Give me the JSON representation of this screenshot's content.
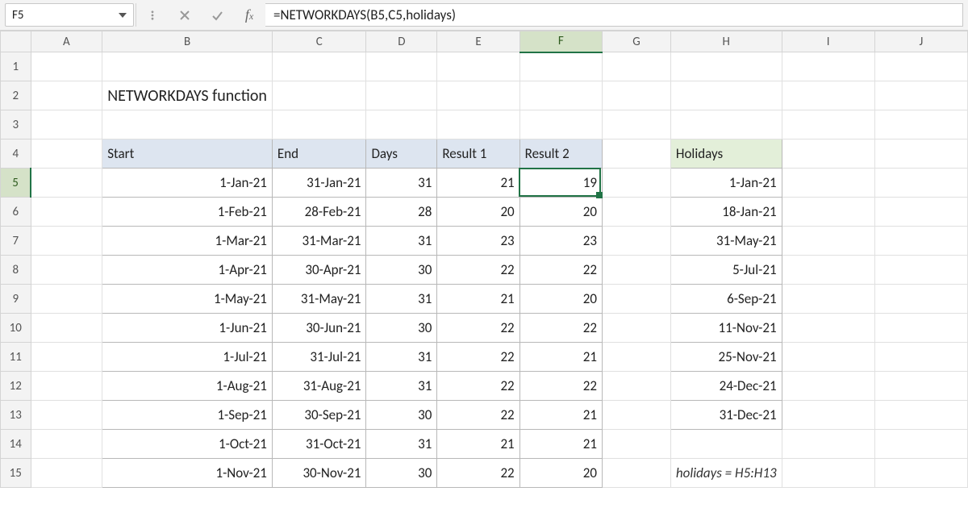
{
  "name_box": "F5",
  "formula": "=NETWORKDAYS(B5,C5,holidays)",
  "columns": [
    "A",
    "B",
    "C",
    "D",
    "E",
    "F",
    "G",
    "H",
    "I",
    "J"
  ],
  "active_column": "F",
  "active_row": 5,
  "title": "NETWORKDAYS function",
  "headers": {
    "start": "Start",
    "end": "End",
    "days": "Days",
    "r1": "Result 1",
    "r2": "Result 2",
    "holidays": "Holidays"
  },
  "rows": [
    {
      "start": "1-Jan-21",
      "end": "31-Jan-21",
      "days": 31,
      "r1": 21,
      "r2": 19
    },
    {
      "start": "1-Feb-21",
      "end": "28-Feb-21",
      "days": 28,
      "r1": 20,
      "r2": 20
    },
    {
      "start": "1-Mar-21",
      "end": "31-Mar-21",
      "days": 31,
      "r1": 23,
      "r2": 23
    },
    {
      "start": "1-Apr-21",
      "end": "30-Apr-21",
      "days": 30,
      "r1": 22,
      "r2": 22
    },
    {
      "start": "1-May-21",
      "end": "31-May-21",
      "days": 31,
      "r1": 21,
      "r2": 20
    },
    {
      "start": "1-Jun-21",
      "end": "30-Jun-21",
      "days": 30,
      "r1": 22,
      "r2": 22
    },
    {
      "start": "1-Jul-21",
      "end": "31-Jul-21",
      "days": 31,
      "r1": 22,
      "r2": 21
    },
    {
      "start": "1-Aug-21",
      "end": "31-Aug-21",
      "days": 31,
      "r1": 22,
      "r2": 22
    },
    {
      "start": "1-Sep-21",
      "end": "30-Sep-21",
      "days": 30,
      "r1": 22,
      "r2": 21
    },
    {
      "start": "1-Oct-21",
      "end": "31-Oct-21",
      "days": 31,
      "r1": 21,
      "r2": 21
    },
    {
      "start": "1-Nov-21",
      "end": "30-Nov-21",
      "days": 30,
      "r1": 22,
      "r2": 20
    }
  ],
  "holidays": [
    "1-Jan-21",
    "18-Jan-21",
    "31-May-21",
    "5-Jul-21",
    "6-Sep-21",
    "11-Nov-21",
    "25-Nov-21",
    "24-Dec-21",
    "31-Dec-21"
  ],
  "note": "holidays = H5:H13"
}
